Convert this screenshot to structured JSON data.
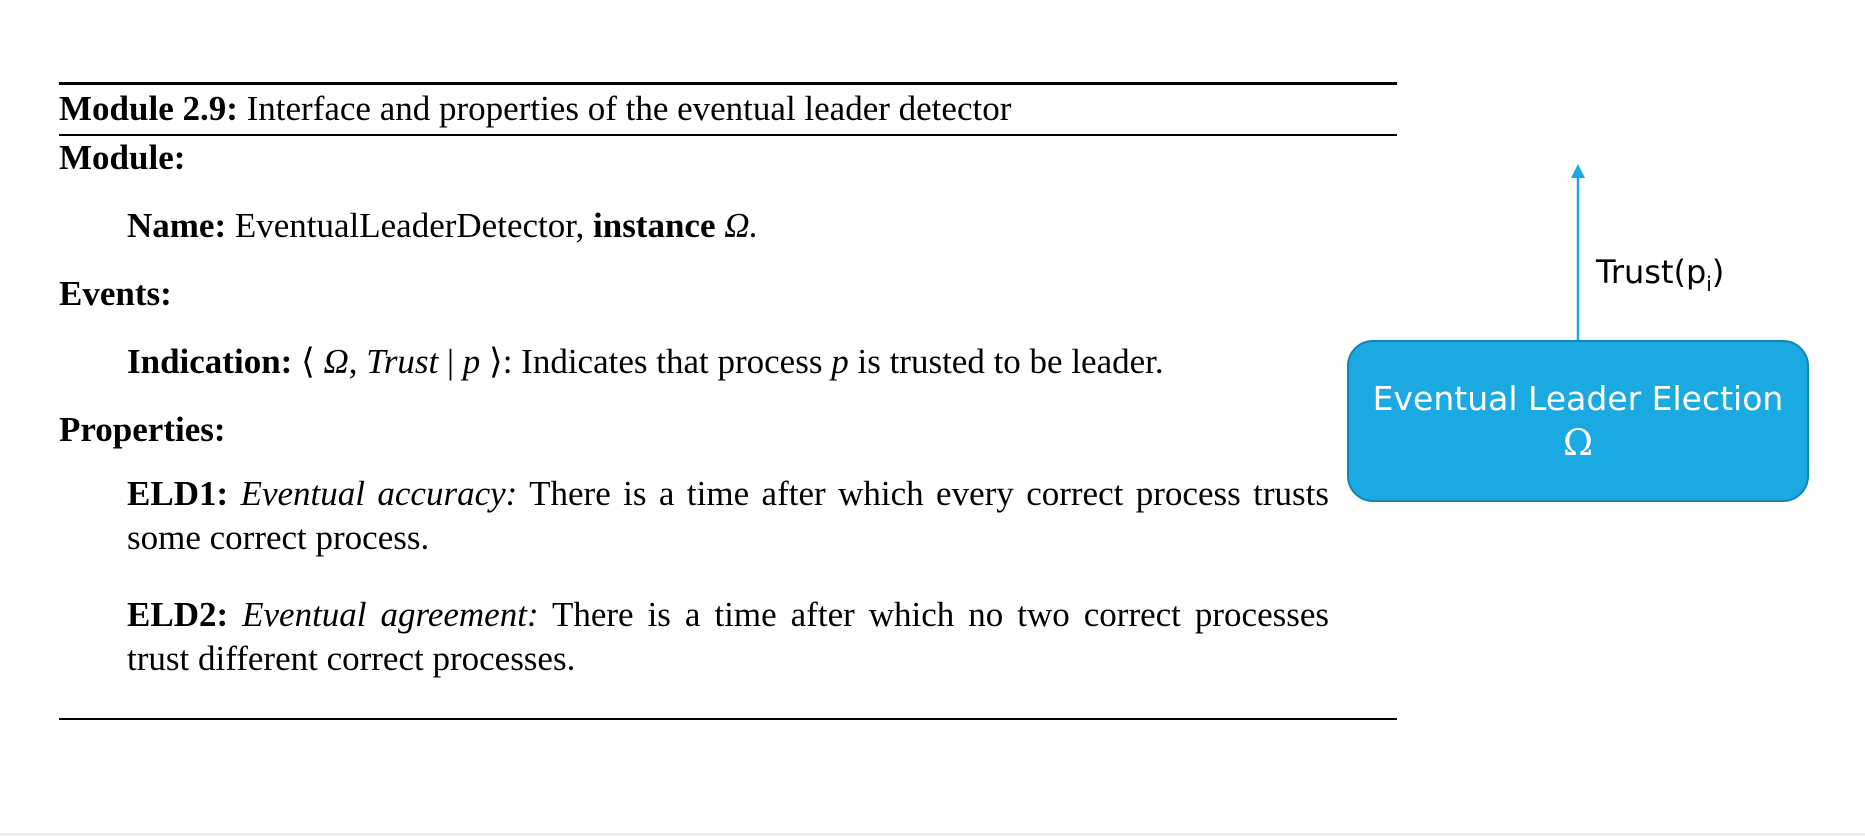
{
  "module_box": {
    "title_label": "Module 2.9:",
    "title_text": "Interface and properties of the eventual leader detector",
    "module_heading": "Module:",
    "name_label": "Name:",
    "name_value": "EventualLeaderDetector,",
    "instance_label": "instance",
    "instance_symbol": "Ω.",
    "events_heading": "Events:",
    "indication_label": "Indication:",
    "indication_open": "⟨ ",
    "indication_omega": "Ω",
    "indication_comma": ", ",
    "indication_trust": "Trust",
    "indication_bar": " | ",
    "indication_p": "p",
    "indication_close": " ⟩",
    "indication_desc_1": ": Indicates that process ",
    "indication_desc_p": "p",
    "indication_desc_2": " is trusted to be leader.",
    "properties_heading": "Properties:",
    "eld1_label": "ELD1:",
    "eld1_name": "Eventual accuracy:",
    "eld1_text": "There is a time after which every correct process trusts some correct process.",
    "eld2_label": "ELD2:",
    "eld2_name": "Eventual agreement:",
    "eld2_text": "There is a time after which no two correct processes trust different correct processes."
  },
  "diagram": {
    "box_title": "Eventual Leader Election",
    "box_symbol": "Ω",
    "arrow_label": "Trust(p",
    "arrow_label_sub": "i",
    "arrow_label_end": ")",
    "box_color": "#1aa9e0",
    "arrow_color": "#1aa9e0"
  }
}
